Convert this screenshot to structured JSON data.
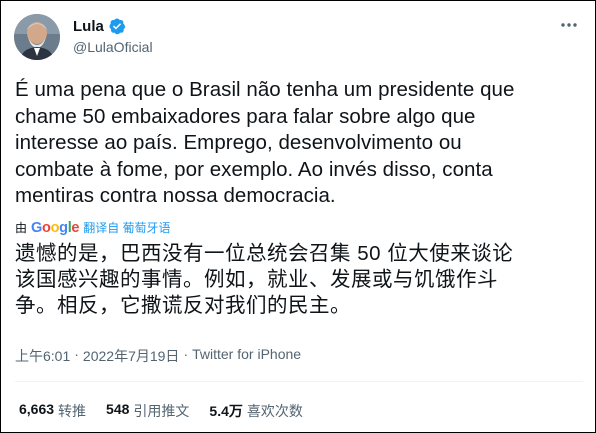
{
  "author": {
    "display_name": "Lula",
    "handle": "@LulaOficial",
    "verified_icon": "verified-badge-icon"
  },
  "tweet": {
    "text": "É uma pena que o Brasil não tenha um presidente que\nchame 50 embaixadores para falar sobre algo que\ninteresse ao país. Emprego, desenvolvimento ou\ncombate à fome, por exemplo. Ao invés disso, conta\nmentiras contra nossa democracia.",
    "translation": {
      "by_label": "由",
      "provider": "Google",
      "from_label": "翻译自 葡萄牙语",
      "text": "遗憾的是，巴西没有一位总统会召集 50 位大使来谈论\n该国感兴趣的事情。例如，就业、发展或与饥饿作斗\n争。相反，它撒谎反对我们的民主。"
    },
    "time": "上午6:01",
    "separator": "·",
    "date": "2022年7月19日",
    "source": "Twitter for iPhone"
  },
  "stats": [
    {
      "value": "6,663",
      "label": "转推"
    },
    {
      "value": "548",
      "label": "引用推文"
    },
    {
      "value": "5.4万",
      "label": "喜欢次数"
    }
  ],
  "colors": {
    "accent": "#1d9bf0",
    "muted": "#536471",
    "text": "#0f1419",
    "google_blue": "#4285f4",
    "google_red": "#ea4335",
    "google_yellow": "#fbbc05",
    "google_green": "#34a853"
  }
}
